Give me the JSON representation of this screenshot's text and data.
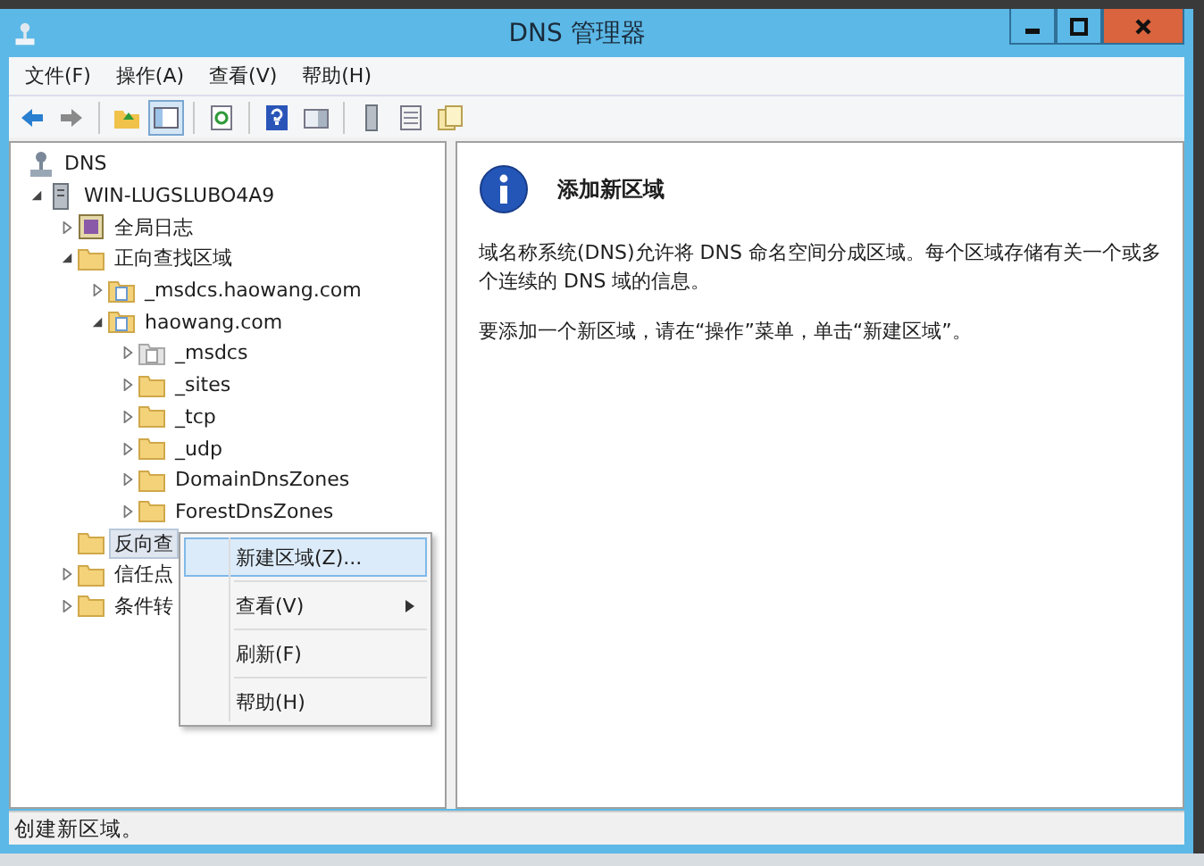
{
  "window": {
    "title": "DNS 管理器"
  },
  "menu": [
    "文件(F)",
    "操作(A)",
    "查看(V)",
    "帮助(H)"
  ],
  "toolbar": [
    {
      "kind": "back",
      "pressed": false
    },
    {
      "kind": "forward",
      "pressed": false
    },
    {
      "kind": "sep"
    },
    {
      "kind": "up",
      "pressed": false
    },
    {
      "kind": "tree",
      "pressed": true
    },
    {
      "kind": "sep"
    },
    {
      "kind": "refresh",
      "pressed": false
    },
    {
      "kind": "sep"
    },
    {
      "kind": "help",
      "pressed": false
    },
    {
      "kind": "pane",
      "pressed": false
    },
    {
      "kind": "sep"
    },
    {
      "kind": "server",
      "pressed": false
    },
    {
      "kind": "list",
      "pressed": false
    },
    {
      "kind": "newdoc",
      "pressed": false
    }
  ],
  "tree": [
    {
      "label": "DNS",
      "kind": "dns",
      "expandable": false,
      "selected": false,
      "children": [
        {
          "label": "WIN-LUGSLUBO4A9",
          "kind": "server",
          "expandable": true,
          "expanded": true,
          "selected": false,
          "children": [
            {
              "label": "全局日志",
              "kind": "log",
              "expandable": true,
              "expanded": false,
              "selected": false
            },
            {
              "label": "正向查找区域",
              "kind": "folder",
              "expandable": true,
              "expanded": true,
              "selected": false,
              "children": [
                {
                  "label": "_msdcs.haowang.com",
                  "kind": "zone",
                  "expandable": true,
                  "expanded": false,
                  "selected": false
                },
                {
                  "label": "haowang.com",
                  "kind": "zone",
                  "expandable": true,
                  "expanded": true,
                  "selected": false,
                  "children": [
                    {
                      "label": "_msdcs",
                      "kind": "zone-gray",
                      "expandable": true,
                      "expanded": false,
                      "selected": false
                    },
                    {
                      "label": "_sites",
                      "kind": "folder",
                      "expandable": true,
                      "expanded": false,
                      "selected": false
                    },
                    {
                      "label": "_tcp",
                      "kind": "folder",
                      "expandable": true,
                      "expanded": false,
                      "selected": false
                    },
                    {
                      "label": "_udp",
                      "kind": "folder",
                      "expandable": true,
                      "expanded": false,
                      "selected": false
                    },
                    {
                      "label": "DomainDnsZones",
                      "kind": "folder",
                      "expandable": true,
                      "expanded": false,
                      "selected": false
                    },
                    {
                      "label": "ForestDnsZones",
                      "kind": "folder",
                      "expandable": true,
                      "expanded": false,
                      "selected": false
                    }
                  ]
                }
              ]
            },
            {
              "label": "反向查",
              "kind": "folder",
              "expandable": false,
              "selected": true
            },
            {
              "label": "信任点",
              "kind": "folder",
              "expandable": true,
              "expanded": false,
              "selected": false
            },
            {
              "label": "条件转",
              "kind": "folder",
              "expandable": true,
              "expanded": false,
              "selected": false
            }
          ]
        }
      ]
    }
  ],
  "context_menu": [
    {
      "label": "新建区域(Z)...",
      "selected": true,
      "submenu": false
    },
    {
      "label": "查看(V)",
      "selected": false,
      "submenu": true
    },
    {
      "label": "刷新(F)",
      "selected": false,
      "submenu": false
    },
    {
      "label": "帮助(H)",
      "selected": false,
      "submenu": false
    }
  ],
  "info": {
    "heading": "添加新区域",
    "paragraphs": [
      "域名称系统(DNS)允许将 DNS 命名空间分成区域。每个区域存储有关一个或多个连续的 DNS 域的信息。",
      "要添加一个新区域，请在“操作”菜单，单击“新建区域”。"
    ]
  },
  "status_bar": "创建新区域。"
}
